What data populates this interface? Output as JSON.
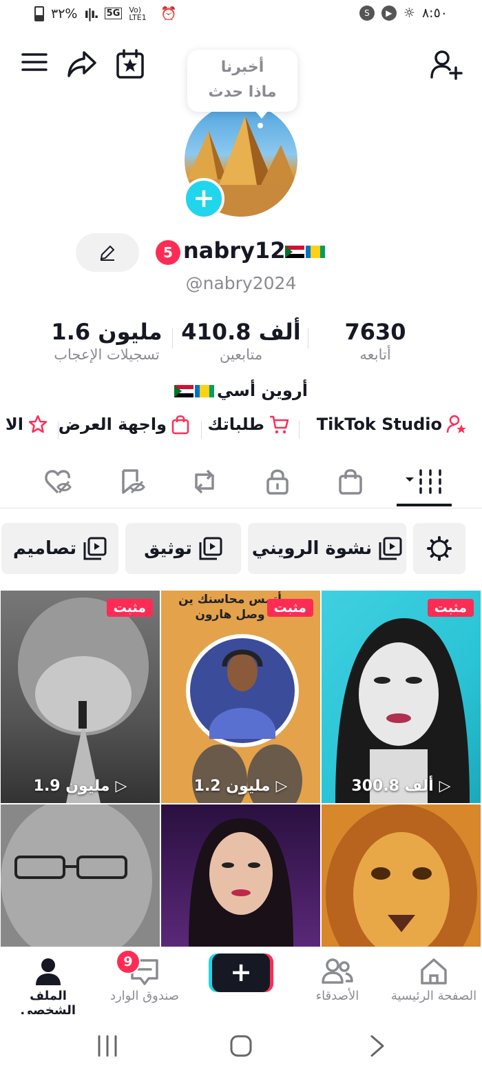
{
  "status_bar": {
    "time": "٨:٥٠",
    "battery": "٣٢%",
    "network": "5G",
    "volte": "Vo) LTE1"
  },
  "header": {
    "tooltip": "أخبرنا ماذا حدث",
    "icons": [
      "menu-icon",
      "share-icon",
      "calendar-star-icon",
      "add-friend-icon"
    ]
  },
  "profile": {
    "notification_count": "5",
    "username": "nabry12",
    "handle": "@nabry2024",
    "bio": "أروين أسي",
    "stats": {
      "following": {
        "value": "7630",
        "label": "أتابعه"
      },
      "followers": {
        "value": "410.8 ألف",
        "label": "متابعين"
      },
      "likes": {
        "value": "1.6 مليون",
        "label": "تسجيلات الإعجاب"
      }
    }
  },
  "links": {
    "studio": "TikTok Studio",
    "orders": "طلباتك",
    "showcase": "واجهة العرض",
    "more": "الا"
  },
  "tabs": [
    "videos-tab",
    "shop-tab",
    "private-tab",
    "reposts-tab",
    "favorites-tab",
    "liked-tab"
  ],
  "playlists": [
    {
      "label": "نشوة الرويني"
    },
    {
      "label": "توثيق"
    },
    {
      "label": "تصاميم"
    }
  ],
  "videos": [
    {
      "pinned": "مثبت",
      "views": "300.8 ألف"
    },
    {
      "pinned": "مثبت",
      "views": "1.2 مليون",
      "caption": "أتمس محاسنك ين وصل هارون"
    },
    {
      "pinned": "مثبت",
      "views": "1.9 مليون"
    },
    {},
    {},
    {}
  ],
  "bottom_nav": {
    "home": "الصفحة الرئيسية",
    "friends": "الأصدقاء",
    "inbox": "صندوق الوارد",
    "inbox_badge": "9",
    "profile": "الملف الشخصي"
  },
  "colors": {
    "accent_red": "#fe2c55",
    "accent_cyan": "#20d5ec",
    "text": "#161823",
    "muted": "#8a8b91"
  }
}
